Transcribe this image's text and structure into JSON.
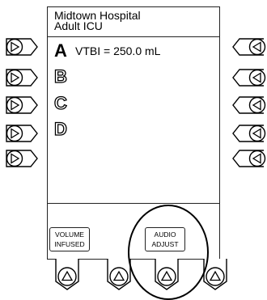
{
  "header": {
    "line1": "Midtown Hospital",
    "line2": "Adult ICU"
  },
  "channels": [
    {
      "letter": "A",
      "text": "VTBI = 250.0 mL"
    },
    {
      "letter": "B",
      "text": ""
    },
    {
      "letter": "C",
      "text": ""
    },
    {
      "letter": "D",
      "text": ""
    }
  ],
  "soft_keys": {
    "volume_infused": {
      "line1": "VOLUME",
      "line2": "INFUSED"
    },
    "audio_adjust": {
      "line1": "AUDIO",
      "line2": "ADJUST"
    }
  },
  "icons": {
    "left_select": "triangle-right-icon",
    "right_select": "triangle-left-icon",
    "bottom_select": "triangle-up-icon"
  },
  "highlight": "audio-adjust-key"
}
